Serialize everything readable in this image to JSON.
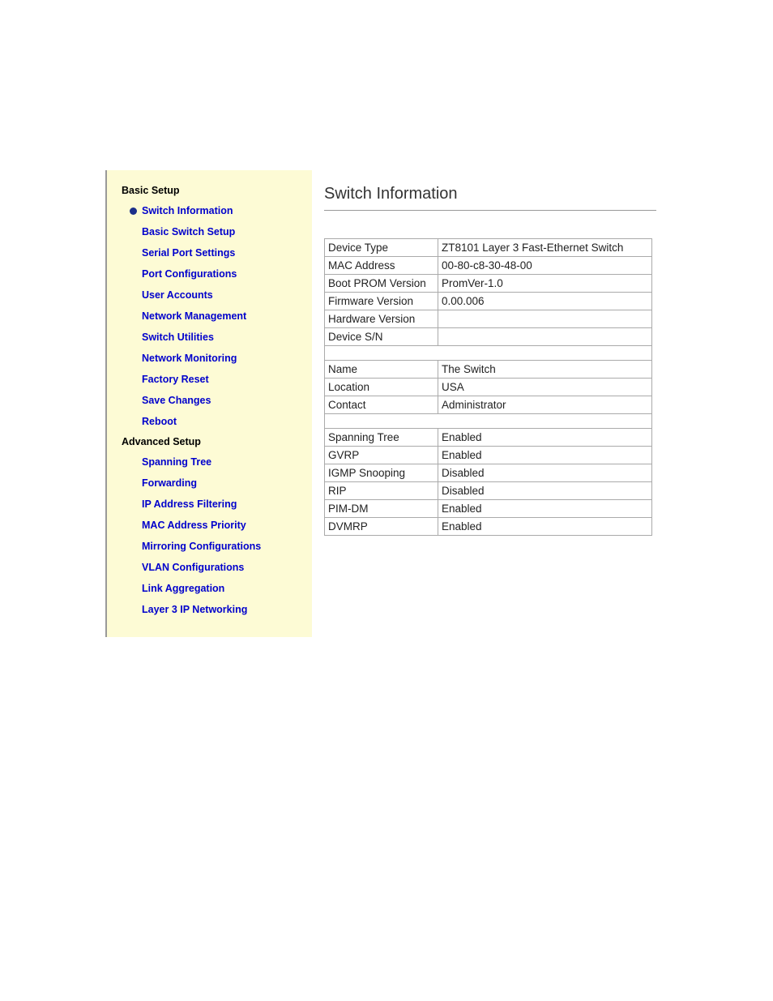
{
  "sidebar": {
    "basic_title": "Basic Setup",
    "advanced_title": "Advanced Setup",
    "basic_items": [
      {
        "label": "Switch Information",
        "active": true
      },
      {
        "label": "Basic Switch Setup"
      },
      {
        "label": "Serial Port Settings"
      },
      {
        "label": "Port Configurations"
      },
      {
        "label": "User Accounts"
      },
      {
        "label": "Network Management"
      },
      {
        "label": "Switch Utilities"
      },
      {
        "label": "Network Monitoring"
      },
      {
        "label": "Factory Reset"
      },
      {
        "label": "Save Changes"
      },
      {
        "label": "Reboot"
      }
    ],
    "advanced_items": [
      {
        "label": "Spanning Tree"
      },
      {
        "label": "Forwarding"
      },
      {
        "label": "IP Address Filtering"
      },
      {
        "label": "MAC Address Priority"
      },
      {
        "label": "Mirroring Configurations"
      },
      {
        "label": "VLAN Configurations"
      },
      {
        "label": "Link Aggregation"
      },
      {
        "label": "Layer 3 IP Networking"
      }
    ]
  },
  "main": {
    "title": "Switch Information",
    "rows_group1": [
      {
        "label": "Device Type",
        "value": "ZT8101 Layer 3 Fast-Ethernet Switch"
      },
      {
        "label": "MAC Address",
        "value": "00-80-c8-30-48-00"
      },
      {
        "label": "Boot PROM Version",
        "value": "PromVer-1.0"
      },
      {
        "label": "Firmware Version",
        "value": "0.00.006"
      },
      {
        "label": "Hardware Version",
        "value": ""
      },
      {
        "label": "Device S/N",
        "value": ""
      }
    ],
    "rows_group2": [
      {
        "label": "Name",
        "value": "The Switch"
      },
      {
        "label": "Location",
        "value": "USA"
      },
      {
        "label": "Contact",
        "value": "Administrator"
      }
    ],
    "rows_group3": [
      {
        "label": "Spanning Tree",
        "value": "Enabled"
      },
      {
        "label": "GVRP",
        "value": "Enabled"
      },
      {
        "label": "IGMP Snooping",
        "value": "Disabled"
      },
      {
        "label": "RIP",
        "value": "Disabled"
      },
      {
        "label": "PIM-DM",
        "value": "Enabled"
      },
      {
        "label": "DVMRP",
        "value": "Enabled"
      }
    ]
  }
}
